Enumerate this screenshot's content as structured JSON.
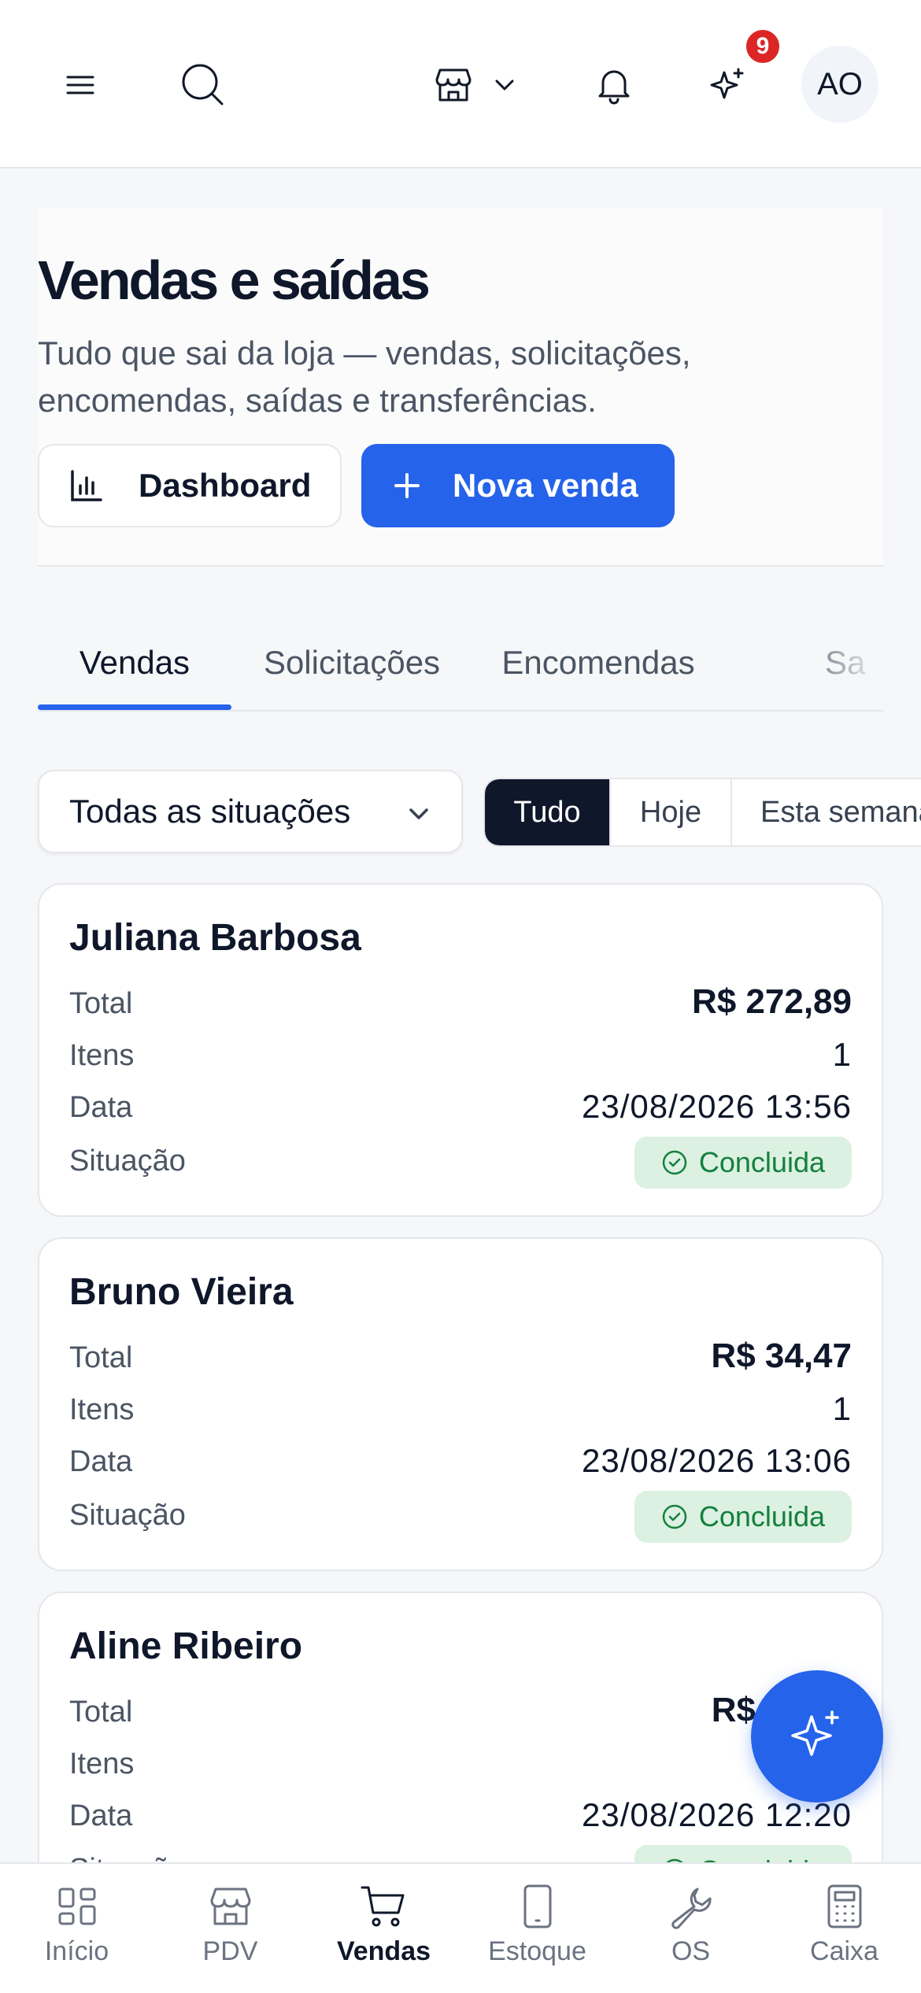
{
  "topbar": {
    "notification_count": "9",
    "avatar_initials": "AO"
  },
  "header": {
    "title": "Vendas e saídas",
    "subtitle": "Tudo que sai da loja — vendas, solicitações, encomendas, saídas e transferências.",
    "dashboard_label": "Dashboard",
    "new_sale_label": "Nova venda"
  },
  "tabs": [
    {
      "label": "Vendas",
      "active": true
    },
    {
      "label": "Solicitações",
      "active": false
    },
    {
      "label": "Encomendas",
      "active": false
    },
    {
      "label": "Sa",
      "active": false
    }
  ],
  "filters": {
    "status_value": "Todas as situações",
    "periods": [
      {
        "label": "Tudo",
        "active": true
      },
      {
        "label": "Hoje",
        "active": false
      },
      {
        "label": "Esta semana",
        "active": false
      }
    ]
  },
  "labels": {
    "total": "Total",
    "items": "Itens",
    "date": "Data",
    "status": "Situação"
  },
  "sales": [
    {
      "customer": "Juliana Barbosa",
      "total": "R$ 272,89",
      "items": "1",
      "date": "23/08/2026 13:56",
      "status": "Concluida"
    },
    {
      "customer": "Bruno Vieira",
      "total": "R$ 34,47",
      "items": "1",
      "date": "23/08/2026 13:06",
      "status": "Concluida"
    },
    {
      "customer": "Aline Ribeiro",
      "total": "R$",
      "items": "",
      "date": "23/08/2026 12:20",
      "status": "Concluida"
    }
  ],
  "bottom_nav": [
    {
      "label": "Início",
      "icon": "grid-icon",
      "active": false
    },
    {
      "label": "PDV",
      "icon": "store-icon",
      "active": false
    },
    {
      "label": "Vendas",
      "icon": "cart-icon",
      "active": true
    },
    {
      "label": "Estoque",
      "icon": "phone-icon",
      "active": false
    },
    {
      "label": "OS",
      "icon": "wrench-icon",
      "active": false
    },
    {
      "label": "Caixa",
      "icon": "calculator-icon",
      "active": false
    }
  ],
  "colors": {
    "accent": "#2563eb",
    "dark": "#0f172a",
    "success_bg": "#dcf1e2",
    "success_text": "#15803d",
    "badge": "#dc2626"
  }
}
